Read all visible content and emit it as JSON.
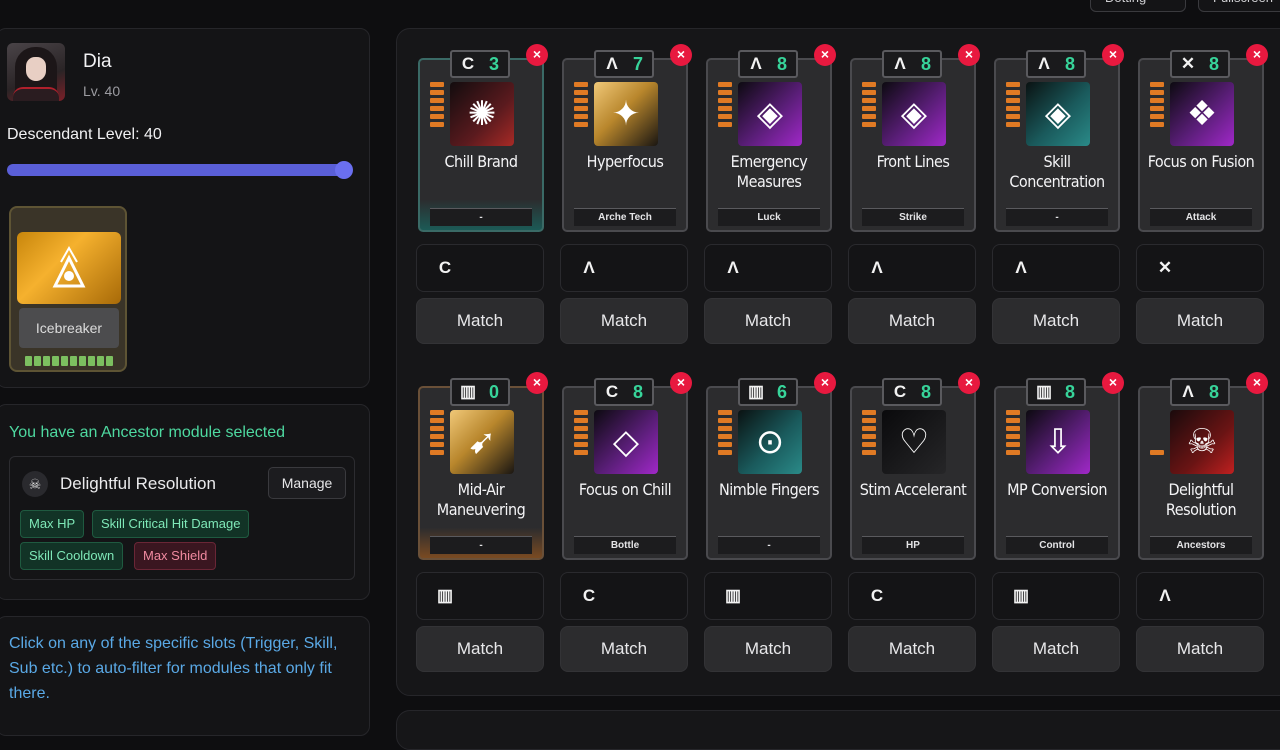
{
  "top_buttons": [
    "Dotting",
    "Fullscreen"
  ],
  "descendant": {
    "name": "Dia",
    "level_text": "Lv. 40",
    "descendant_level_label": "Descendant Level: 40",
    "slider_fraction": 1.0
  },
  "ancestor": {
    "card_label": "Icebreaker",
    "note": "You have an Ancestor module selected",
    "module_name": "Delightful Resolution",
    "manage_label": "Manage",
    "tags": [
      {
        "label": "Max HP",
        "tone": "green"
      },
      {
        "label": "Skill Critical Hit Damage",
        "tone": "green"
      },
      {
        "label": "Skill Cooldown",
        "tone": "green"
      },
      {
        "label": "Max Shield",
        "tone": "red"
      }
    ]
  },
  "help_text": "Click on any of the specific slots (Trigger, Skill, Sub etc.) to auto-filter for modules that only fit there.",
  "match_label": "Match",
  "colors": {
    "capacity": "#37d49a",
    "remove": "#e8193f",
    "help": "#5aa9e6",
    "note": "#4ed9a0",
    "accent": "#5a5fd8"
  },
  "modules": [
    {
      "name": "Chill Brand",
      "symbol": "C",
      "socket_icon": "crescent-icon",
      "capacity": "3",
      "category": "-",
      "art": "red",
      "glyph": "✺",
      "edge": "teal",
      "bars": 6
    },
    {
      "name": "Hyperfocus",
      "symbol": "Λ",
      "socket_icon": "caret-icon",
      "capacity": "7",
      "category": "Arche Tech",
      "art": "gold",
      "glyph": "✦",
      "edge": "",
      "bars": 6
    },
    {
      "name": "Emergency Measures",
      "symbol": "Λ",
      "socket_icon": "caret-icon",
      "capacity": "8",
      "category": "Luck",
      "art": "purple",
      "glyph": "◈",
      "edge": "",
      "bars": 6
    },
    {
      "name": "Front Lines",
      "symbol": "Λ",
      "socket_icon": "caret-icon",
      "capacity": "8",
      "category": "Strike",
      "art": "purple",
      "glyph": "◈",
      "edge": "",
      "bars": 6
    },
    {
      "name": "Skill Concentration",
      "symbol": "Λ",
      "socket_icon": "caret-icon",
      "capacity": "8",
      "category": "-",
      "art": "teal",
      "glyph": "◈",
      "edge": "",
      "bars": 6
    },
    {
      "name": "Focus on Fusion",
      "symbol": "✕",
      "socket_icon": "cross-icon",
      "capacity": "8",
      "category": "Attack",
      "art": "purple",
      "glyph": "❖",
      "edge": "",
      "bars": 6
    },
    {
      "name": "Mid-Air Maneuvering",
      "symbol": "▥",
      "socket_icon": "stripes-icon",
      "capacity": "0",
      "category": "-",
      "art": "gold",
      "glyph": "➹",
      "edge": "orange",
      "bars": 6
    },
    {
      "name": "Focus on Chill",
      "symbol": "C",
      "socket_icon": "crescent-icon",
      "capacity": "8",
      "category": "Bottle",
      "art": "purple",
      "glyph": "◇",
      "edge": "",
      "bars": 6
    },
    {
      "name": "Nimble Fingers",
      "symbol": "▥",
      "socket_icon": "stripes-icon",
      "capacity": "6",
      "category": "-",
      "art": "teal",
      "glyph": "⊙",
      "edge": "",
      "bars": 6
    },
    {
      "name": "Stim Accelerant",
      "symbol": "C",
      "socket_icon": "crescent-icon",
      "capacity": "8",
      "category": "HP",
      "art": "dark",
      "glyph": "♡",
      "edge": "",
      "bars": 6
    },
    {
      "name": "MP Conversion",
      "symbol": "▥",
      "socket_icon": "stripes-icon",
      "capacity": "8",
      "category": "Control",
      "art": "purple",
      "glyph": "⇩",
      "edge": "",
      "bars": 6
    },
    {
      "name": "Delightful Resolution",
      "symbol": "Λ",
      "socket_icon": "caret-icon",
      "capacity": "8",
      "category": "Ancestors",
      "art": "crimson",
      "glyph": "☠",
      "edge": "",
      "bars": 1
    }
  ]
}
